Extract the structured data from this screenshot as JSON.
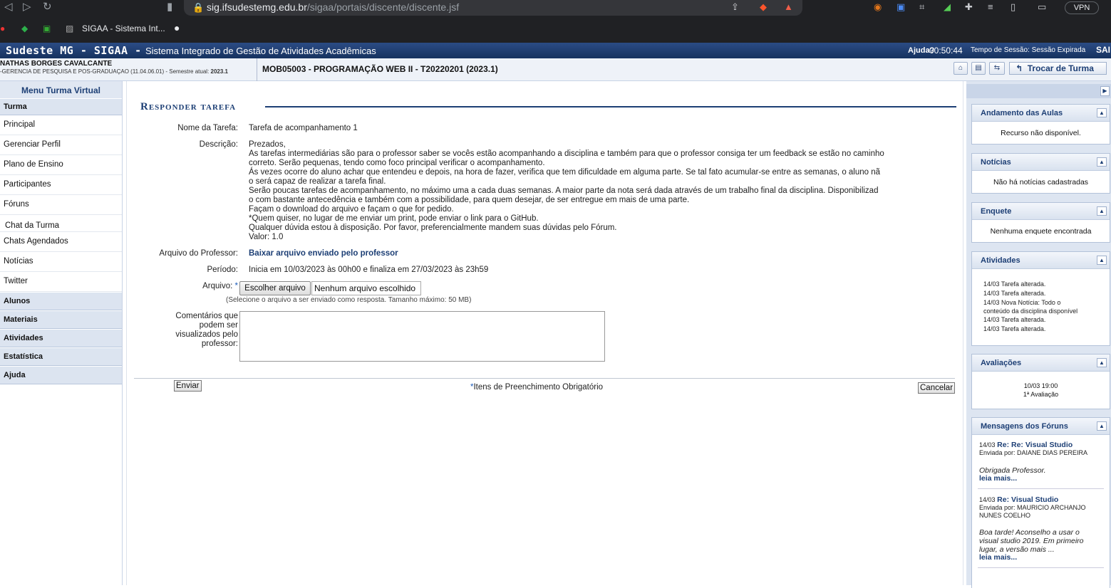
{
  "browser": {
    "url_domain": "sig.ifsudestemg.edu.br",
    "url_path": "/sigaa/portais/discente/discente.jsf",
    "vpn_label": "VPN",
    "bookmark_label": "SIGAA - Sistema Int..."
  },
  "header": {
    "brand": "Sudeste MG - SIGAA -",
    "system_name": "Sistema Integrado de Gestão de Atividades Acadêmicas",
    "help": "Ajuda?",
    "timer": "00:50:44",
    "session": "Tempo de Sessão: Sessão Expirada",
    "exit": "SAI"
  },
  "user": {
    "name": "NATHAS BORGES CAVALCANTE",
    "unit": "-GERENCIA DE PESQUISA E POS-GRADUAÇAO (11.04.06.01) - Semestre atual:",
    "semester": "2023.1",
    "course": "MOB05003 - PROGRAMAÇÃO WEB II - T20220201 (2023.1)",
    "switch_class": "Trocar de Turma"
  },
  "menu": {
    "title": "Menu Turma Virtual",
    "turma_section": "Turma",
    "items": [
      "Principal",
      "Gerenciar Perfil",
      "Plano de Ensino",
      "Participantes",
      "Fóruns",
      "Chat da Turma",
      "Chats Agendados",
      "Notícias",
      "Twitter"
    ],
    "sections": [
      "Alunos",
      "Materiais",
      "Atividades",
      "Estatística",
      "Ajuda"
    ]
  },
  "form": {
    "title": "Responder tarefa",
    "task_name_label": "Nome da Tarefa:",
    "task_name": "Tarefa de acompanhamento 1",
    "description_label": "Descrição:",
    "description_lines": [
      "Prezados,",
      "As tarefas intermediárias são para o professor saber se vocês estão acompanhando a disciplina e também para que o professor consiga ter um feedback se estão no caminho",
      "correto. Serão pequenas, tendo como foco principal verificar o acompanhamento.",
      "Ás vezes ocorre do aluno achar que entendeu e depois, na hora de fazer, verifica que tem dificuldade em alguma parte. Se tal fato acumular-se entre as semanas, o aluno nã",
      "o será capaz de realizar a tarefa final.",
      "Serão poucas tarefas de acompanhamento, no máximo uma a cada duas semanas. A maior parte da nota será dada através de um trabalho final da disciplina. Disponibilizad",
      "o com bastante antecedência e também com a possibilidade, para quem desejar, de ser entregue em mais de uma parte.",
      "Façam o download do arquivo e façam o que for pedido.",
      "*Quem quiser, no lugar de me enviar um print, pode enviar o link para o GitHub.",
      "Qualquer dúvida estou à disposição. Por favor, preferencialmente mandem suas dúvidas pelo Fórum.",
      "Valor: 1.0"
    ],
    "teacher_file_label": "Arquivo do Professor:",
    "teacher_file_link": "Baixar arquivo enviado pelo professor",
    "period_label": "Período:",
    "period": "Inicia em 10/03/2023 às 00h00 e finaliza em 27/03/2023 às 23h59",
    "file_label": "Arquivo:",
    "file_button": "Escolher arquivo",
    "file_none": "Nenhum arquivo escolhido",
    "file_hint": "(Selecione o arquivo a ser enviado como resposta. Tamanho máximo: 50 MB)",
    "comments_label_lines": [
      "Comentários que",
      "podem ser",
      "visualizados pelo",
      "professor:"
    ],
    "submit": "Enviar",
    "required_note": "Itens de Preenchimento Obrigatório",
    "cancel": "Cancelar"
  },
  "panels": {
    "andamento_title": "Andamento das Aulas",
    "andamento_text": "Recurso não disponível.",
    "noticias_title": "Notícias",
    "noticias_text": "Não há notícias cadastradas",
    "enquete_title": "Enquete",
    "enquete_text": "Nenhuma enquete encontrada",
    "atividades_title": "Atividades",
    "atividades": [
      "14/03 Tarefa alterada.",
      "14/03 Tarefa alterada.",
      "14/03 Nova Notícia: Todo o",
      "conteúdo da disciplina disponível",
      "14/03 Tarefa alterada.",
      "14/03 Tarefa alterada."
    ],
    "avaliacoes_title": "Avaliações",
    "avaliacao_date": "10/03 19:00",
    "avaliacao_name": "1ª Avaliação",
    "forum_title": "Mensagens dos Fóruns",
    "forum": [
      {
        "date": "14/03",
        "subject": "Re: Re: Visual Studio",
        "sender": "Enviada por: DAIANE DIAS PEREIRA",
        "sender2": "",
        "body": [
          "Obrigada Professor."
        ],
        "more": "leia mais..."
      },
      {
        "date": "14/03",
        "subject": "Re: Visual Studio",
        "sender": "Enviada por: MAURICIO ARCHANJO",
        "sender2": "NUNES COELHO",
        "body": [
          "Boa tarde!  Aconselho a usar o",
          "visual studio 2019. Em primeiro",
          "lugar, a versão mais ..."
        ],
        "more": "leia mais..."
      }
    ]
  }
}
